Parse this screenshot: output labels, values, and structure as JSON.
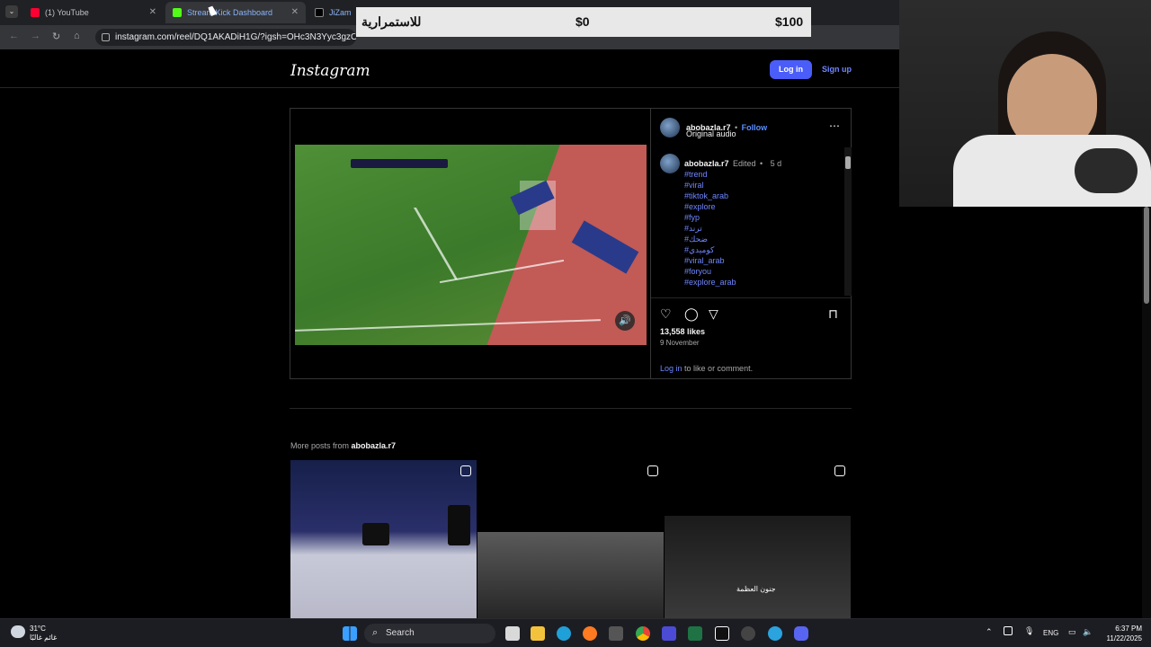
{
  "browser": {
    "tabs": [
      {
        "title": "(1) YouTube",
        "color": "#ff0033"
      },
      {
        "title": "Stream Kick Dashboard",
        "color": "#53fc18"
      },
      {
        "title": "JiZam",
        "color": "#ffffff"
      }
    ],
    "url": "instagram.com/reel/DQ1AKADiH1G/?igsh=OHc3N3Yyc3gzOHJ6"
  },
  "overlay": {
    "label": "للاستمرارية",
    "min": "$0",
    "max": "$100"
  },
  "instagram": {
    "logo": "Instagram",
    "login_label": "Log in",
    "signup_label": "Sign up",
    "post": {
      "username": "abobazla.r7",
      "follow_label": "Follow",
      "audio": "Original audio",
      "caption_meta_edited": "Edited",
      "caption_meta_time": "5 d",
      "hashtags": [
        "#trend",
        "#viral",
        "#tiktok_arab",
        "#explore",
        "#fyp",
        "#ترند",
        "#ضحك",
        "#كوميدي",
        "#viral_arab",
        "#foryou",
        "#explore_arab"
      ],
      "likes": "13,558 likes",
      "date": "9 November",
      "login_link": "Log in",
      "login_suffix": "to like or comment."
    },
    "more_posts_prefix": "More posts from",
    "more_posts_user": "abobazla.r7",
    "thumb_caption": "جنون العظمة"
  },
  "taskbar": {
    "weather_temp": "31°C",
    "weather_desc": "غائم غالبًا",
    "search_label": "Search",
    "lang": "ENG",
    "time": "6:37 PM",
    "date": "11/22/2025"
  }
}
